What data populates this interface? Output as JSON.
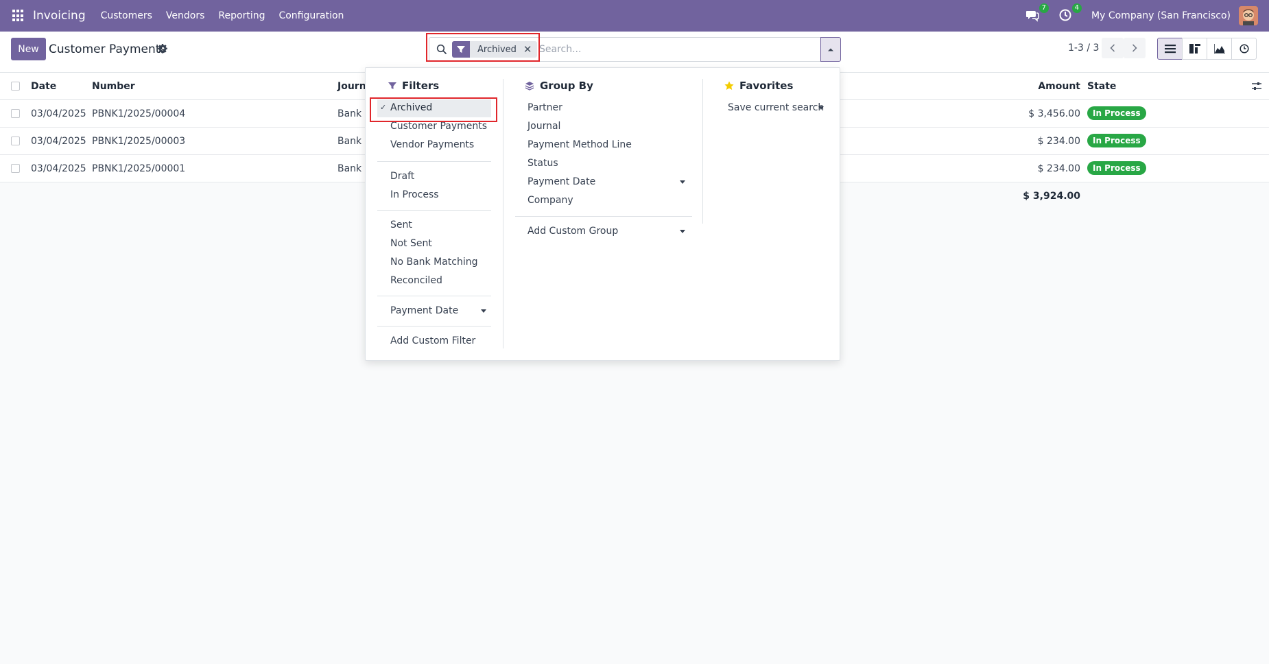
{
  "navbar": {
    "app_name": "Invoicing",
    "menu": [
      "Customers",
      "Vendors",
      "Reporting",
      "Configuration"
    ],
    "messages_count": "7",
    "activities_count": "4",
    "company": "My Company (San Francisco)"
  },
  "control_panel": {
    "new_label": "New",
    "title": "Customer Payments",
    "search": {
      "facet_label": "Archived",
      "placeholder": "Search..."
    },
    "pager": "1-3 / 3"
  },
  "table": {
    "headers": [
      "Date",
      "Number",
      "Journal",
      "Amount",
      "State"
    ],
    "rows": [
      {
        "date": "03/04/2025",
        "number": "PBNK1/2025/00004",
        "journal": "Bank",
        "amount": "$ 3,456.00",
        "state": "In Process"
      },
      {
        "date": "03/04/2025",
        "number": "PBNK1/2025/00003",
        "journal": "Bank",
        "amount": "$ 234.00",
        "state": "In Process"
      },
      {
        "date": "03/04/2025",
        "number": "PBNK1/2025/00001",
        "journal": "Bank",
        "amount": "$ 234.00",
        "state": "In Process"
      }
    ],
    "total": "$ 3,924.00"
  },
  "dropdown": {
    "filters": {
      "title": "Filters",
      "groups": [
        [
          "Archived",
          "Customer Payments",
          "Vendor Payments"
        ],
        [
          "Draft",
          "In Process"
        ],
        [
          "Sent",
          "Not Sent",
          "No Bank Matching",
          "Reconciled"
        ],
        [
          "Payment Date"
        ],
        [
          "Add Custom Filter"
        ]
      ]
    },
    "group_by": {
      "title": "Group By",
      "items": [
        "Partner",
        "Journal",
        "Payment Method Line",
        "Status",
        "Payment Date",
        "Company"
      ],
      "custom": "Add Custom Group"
    },
    "favorites": {
      "title": "Favorites",
      "save_label": "Save current search"
    }
  },
  "colors": {
    "brand": "#71639e",
    "success": "#28a745",
    "highlight": "#e0262b"
  }
}
